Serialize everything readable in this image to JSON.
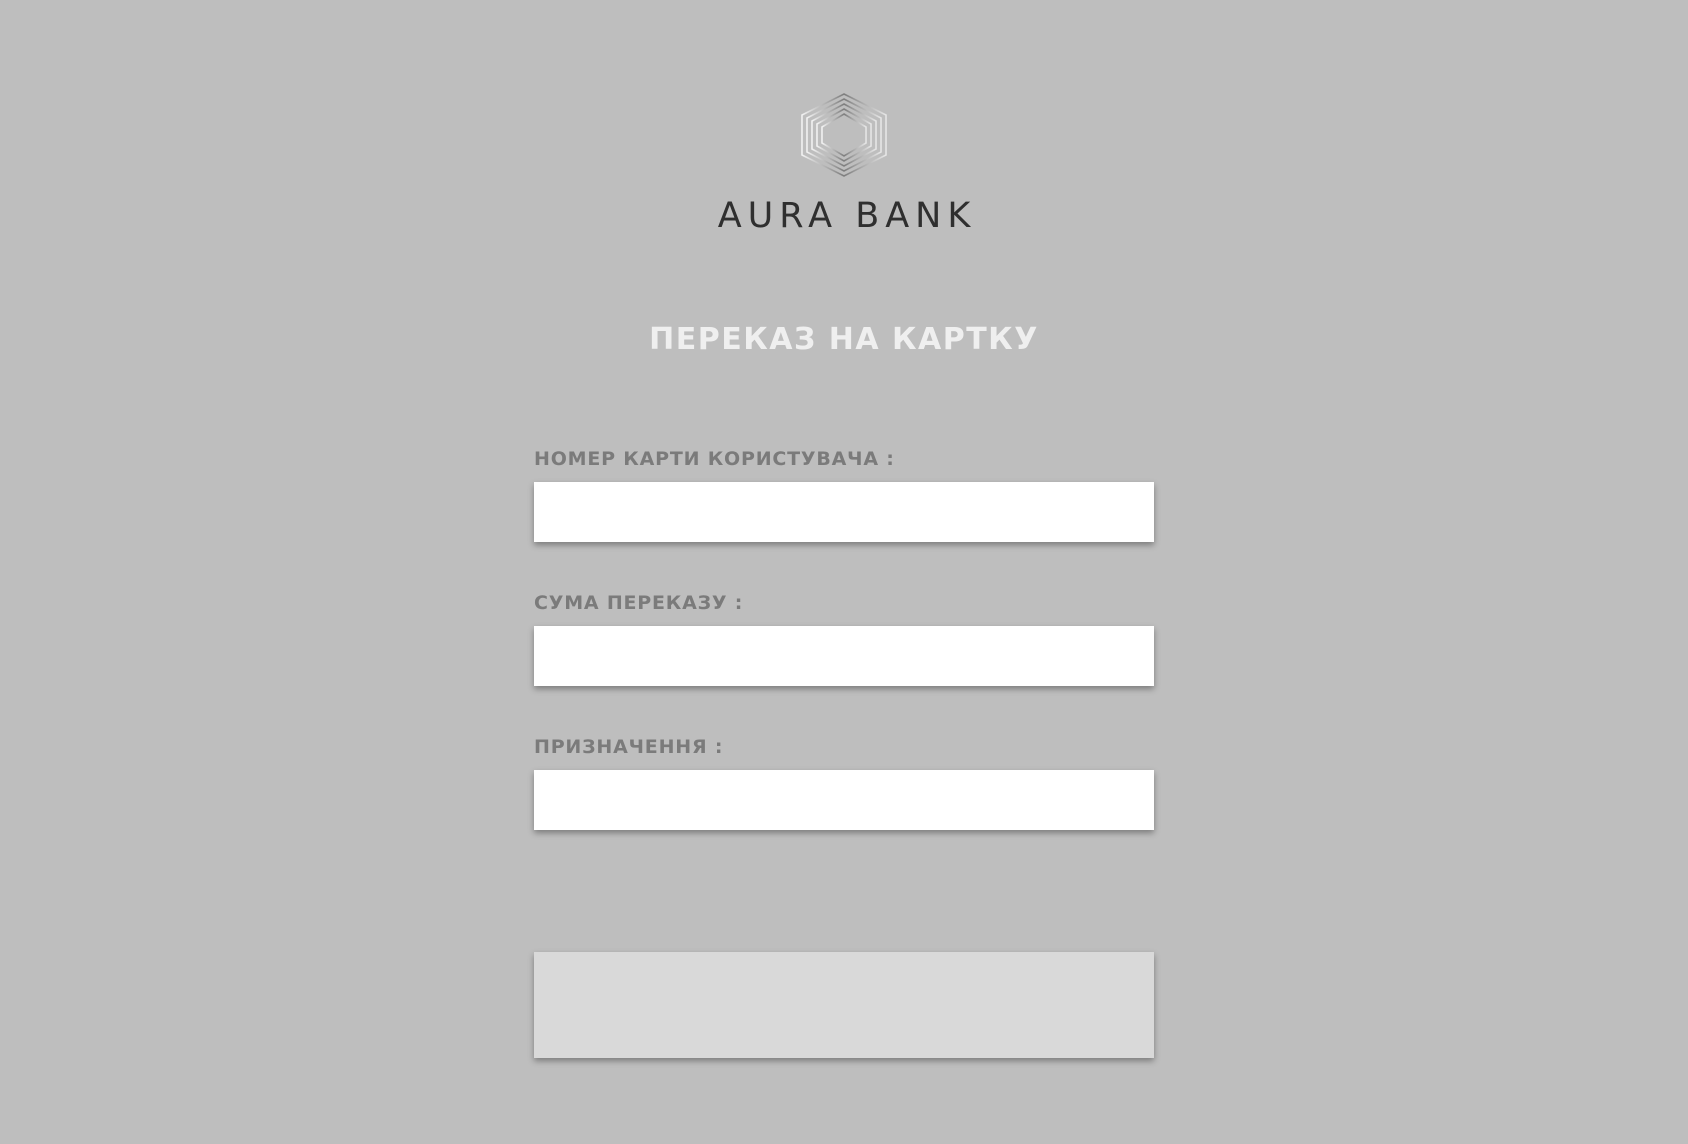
{
  "brand": {
    "name": "AURA BANK",
    "logo_icon": "hexagon-logo-icon"
  },
  "page": {
    "title": "ПЕРЕКАЗ НА КАРТКУ"
  },
  "form": {
    "fields": [
      {
        "label": "НОМЕР КАРТИ КОРИСТУВАЧА :",
        "value": "",
        "placeholder": ""
      },
      {
        "label": "СУМА ПЕРЕКАЗУ :",
        "value": "",
        "placeholder": ""
      },
      {
        "label": "ПРИЗНАЧЕННЯ :",
        "value": "",
        "placeholder": ""
      }
    ],
    "submit_label": ""
  },
  "colors": {
    "background": "#bebebe",
    "input_background": "#ffffff",
    "button_background": "#d9d9d9",
    "label_text": "#7b7b7b",
    "title_text": "#efefef",
    "brand_text": "#2f2f2f"
  }
}
